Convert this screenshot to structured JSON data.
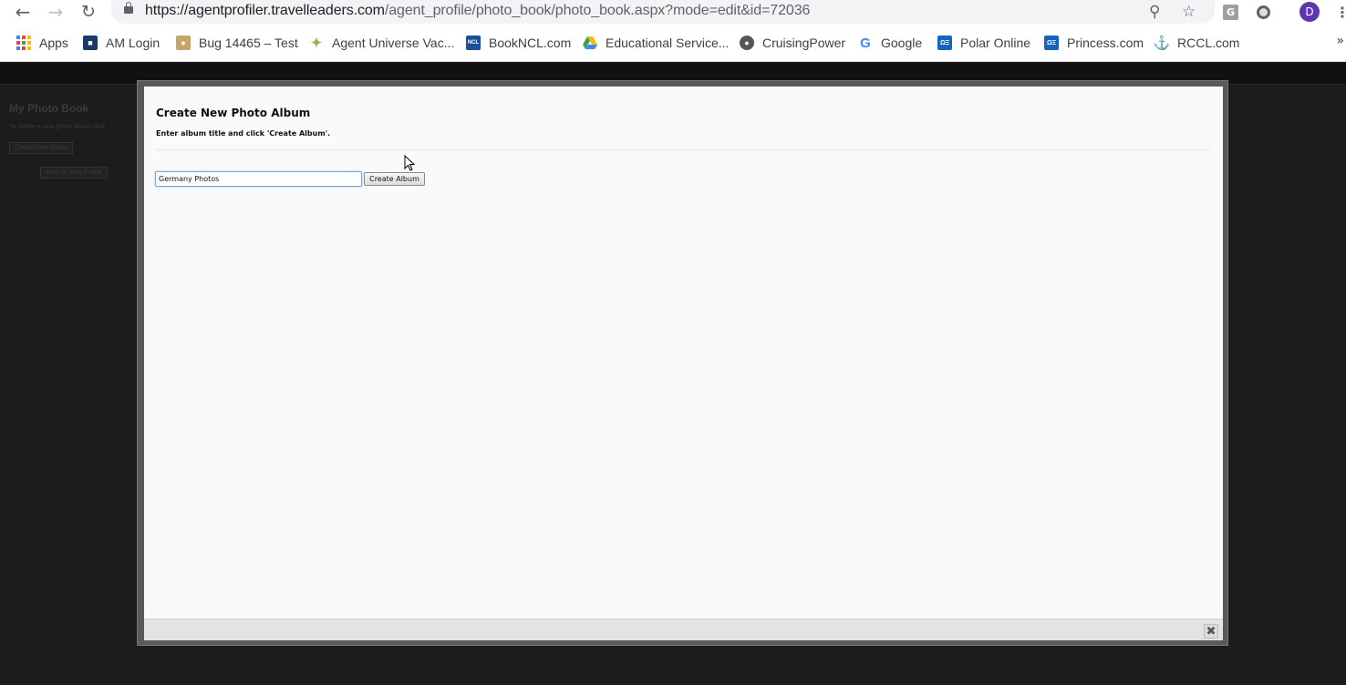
{
  "browser": {
    "url_host": "https://agentprofiler.travelleaders.com",
    "url_path": "/agent_profile/photo_book/photo_book.aspx?mode=edit&id=72036",
    "avatar_letter": "D",
    "extension_letter": "G"
  },
  "bookmarks": [
    {
      "label": "Apps",
      "icon": "apps-grid-icon"
    },
    {
      "label": "AM Login",
      "icon": "am-login-icon",
      "color": "#1a3a6b"
    },
    {
      "label": "Bug 14465 – Test",
      "icon": "bug-icon",
      "color": "#c8a36a"
    },
    {
      "label": "Agent Universe Vac...",
      "icon": "star-burst-icon",
      "color": "#9ab84a"
    },
    {
      "label": "BookNCL.com",
      "icon": "ncl-icon",
      "icon_text": "NCL",
      "color": "#1b4f9c"
    },
    {
      "label": "Educational Service...",
      "icon": "google-drive-icon"
    },
    {
      "label": "CruisingPower",
      "icon": "globe-icon",
      "color": "#555555"
    },
    {
      "label": "Google",
      "icon": "google-icon"
    },
    {
      "label": "Polar Online",
      "icon": "polar-icon",
      "icon_text": "ΩΞ",
      "color": "#1565c0"
    },
    {
      "label": "Princess.com",
      "icon": "princess-icon",
      "icon_text": "ΩΞ",
      "color": "#1565c0"
    },
    {
      "label": "RCCL.com",
      "icon": "rccl-anchor-icon",
      "color": "#1a2a5a"
    }
  ],
  "background_page": {
    "title": "My Photo Book",
    "text": "To create a new photo album click",
    "create_btn": "Create New Album",
    "back_btn": "Back to View Profile"
  },
  "modal": {
    "title": "Create New Photo Album",
    "instructions": "Enter album title and click 'Create Album'.",
    "input_value": "Germany Photos",
    "button_label": "Create Album"
  }
}
